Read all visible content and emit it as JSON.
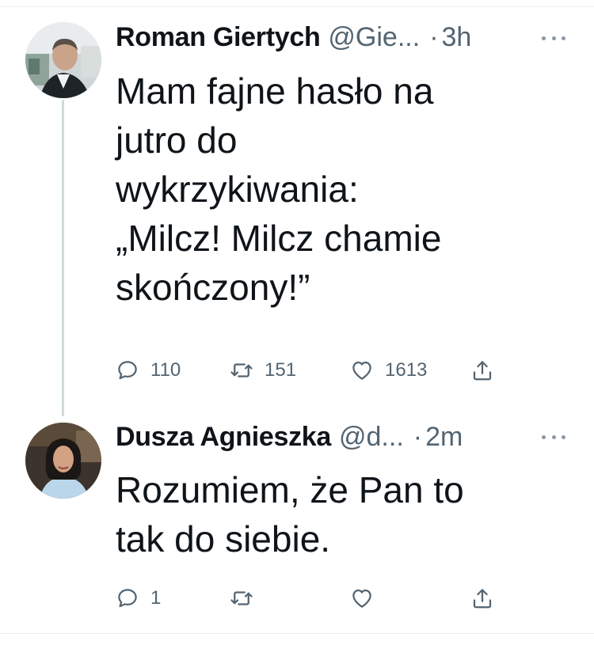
{
  "tweets": [
    {
      "author_name": "Roman Giertych",
      "handle": "@Gie...",
      "separator": "·",
      "time": "3h",
      "text_lines": [
        "Mam fajne hasło na",
        "jutro do",
        "wykrzykiwania:",
        "„Milcz! Milcz chamie",
        "skończony!”"
      ],
      "replies": "110",
      "retweets": "151",
      "likes": "1613",
      "avatar_icon": "person-photo-icon"
    },
    {
      "author_name": "Dusza Agnieszka",
      "handle": "@d...",
      "separator": "·",
      "time": "2m",
      "text_lines": [
        "Rozumiem, że Pan to",
        "tak do siebie."
      ],
      "replies": "1",
      "retweets": "",
      "likes": "",
      "avatar_icon": "person-photo-icon"
    }
  ],
  "icons": {
    "reply": "reply-icon",
    "retweet": "retweet-icon",
    "like": "like-icon",
    "share": "share-icon",
    "more": "more-options-icon"
  },
  "colors": {
    "text": "#0f1419",
    "secondary": "#536471",
    "thread_line": "#cfd9de"
  }
}
